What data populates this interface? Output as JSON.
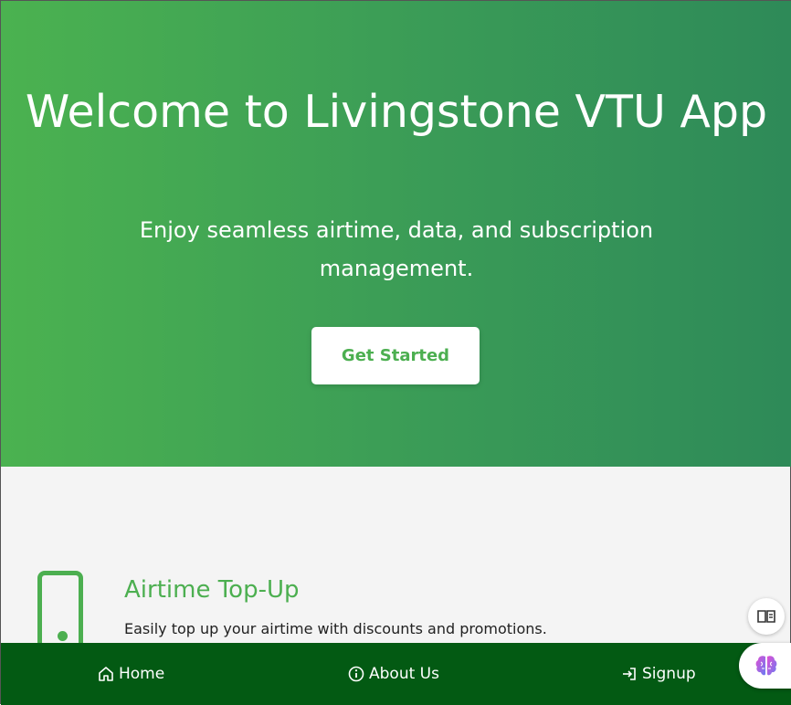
{
  "hero": {
    "title": "Welcome to Livingstone VTU App",
    "subtitle": "Enjoy seamless airtime, data, and subscription management.",
    "cta_label": "Get Started"
  },
  "feature": {
    "icon": "mobile-phone-icon",
    "title": "Airtime Top-Up",
    "description": "Easily top up your airtime with discounts and promotions."
  },
  "nav": {
    "home": {
      "label": "Home",
      "icon": "home-icon"
    },
    "about": {
      "label": "About Us",
      "icon": "info-icon"
    },
    "signup": {
      "label": "Signup",
      "icon": "sign-in-icon"
    }
  },
  "floating": {
    "reader_icon": "open-book-icon",
    "assistant_icon": "brain-icon"
  },
  "colors": {
    "brand_green": "#4caf50",
    "nav_bg": "#035a13",
    "hero_gradient_start": "#4bb250",
    "hero_gradient_end": "#2e8a58"
  }
}
